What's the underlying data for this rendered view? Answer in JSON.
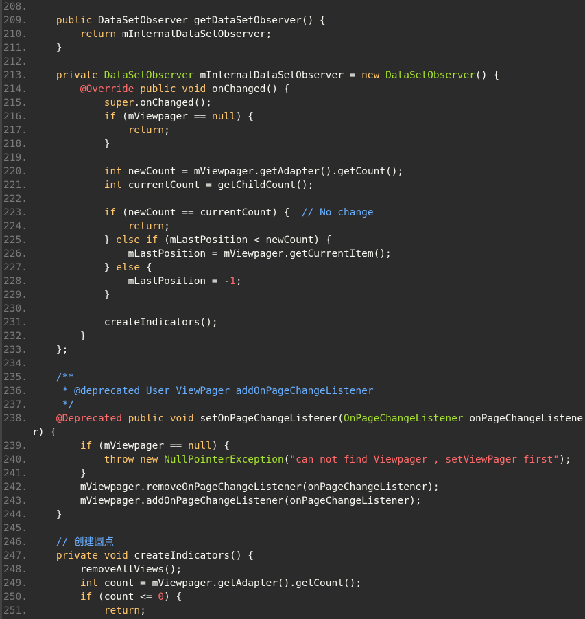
{
  "editor": {
    "lines": [
      {
        "n": "208.",
        "t": []
      },
      {
        "n": "209.",
        "t": [
          [
            "    ",
            "pl"
          ],
          [
            "public ",
            "kw"
          ],
          [
            "DataSetObserver ",
            "pl"
          ],
          [
            "getDataSetObserver() {",
            "pl"
          ]
        ]
      },
      {
        "n": "210.",
        "t": [
          [
            "        ",
            "pl"
          ],
          [
            "return ",
            "kw"
          ],
          [
            "mInternalDataSetObserver;",
            "pl"
          ]
        ]
      },
      {
        "n": "211.",
        "t": [
          [
            "    }",
            "pl"
          ]
        ]
      },
      {
        "n": "212.",
        "t": []
      },
      {
        "n": "213.",
        "t": [
          [
            "    ",
            "pl"
          ],
          [
            "private ",
            "kw"
          ],
          [
            "DataSetObserver ",
            "ty"
          ],
          [
            "mInternalDataSetObserver = ",
            "pl"
          ],
          [
            "new ",
            "kw"
          ],
          [
            "DataSetObserver",
            "ty"
          ],
          [
            "() {",
            "pl"
          ]
        ]
      },
      {
        "n": "214.",
        "t": [
          [
            "        ",
            "pl"
          ],
          [
            "@Override ",
            "ann"
          ],
          [
            "public void ",
            "kw"
          ],
          [
            "onChanged() {",
            "pl"
          ]
        ]
      },
      {
        "n": "215.",
        "t": [
          [
            "            ",
            "pl"
          ],
          [
            "super",
            "kw"
          ],
          [
            ".onChanged();",
            "pl"
          ]
        ]
      },
      {
        "n": "216.",
        "t": [
          [
            "            ",
            "pl"
          ],
          [
            "if ",
            "kw"
          ],
          [
            "(mViewpager == ",
            "pl"
          ],
          [
            "null",
            "kw"
          ],
          [
            ") {",
            "pl"
          ]
        ]
      },
      {
        "n": "217.",
        "t": [
          [
            "                ",
            "pl"
          ],
          [
            "return",
            "kw"
          ],
          [
            ";",
            "pl"
          ]
        ]
      },
      {
        "n": "218.",
        "t": [
          [
            "            }",
            "pl"
          ]
        ]
      },
      {
        "n": "219.",
        "t": []
      },
      {
        "n": "220.",
        "t": [
          [
            "            ",
            "pl"
          ],
          [
            "int ",
            "kw"
          ],
          [
            "newCount = mViewpager.getAdapter().getCount();",
            "pl"
          ]
        ]
      },
      {
        "n": "221.",
        "t": [
          [
            "            ",
            "pl"
          ],
          [
            "int ",
            "kw"
          ],
          [
            "currentCount = getChildCount();",
            "pl"
          ]
        ]
      },
      {
        "n": "222.",
        "t": []
      },
      {
        "n": "223.",
        "t": [
          [
            "            ",
            "pl"
          ],
          [
            "if ",
            "kw"
          ],
          [
            "(newCount == currentCount) {  ",
            "pl"
          ],
          [
            "// No change",
            "cm"
          ]
        ]
      },
      {
        "n": "224.",
        "t": [
          [
            "                ",
            "pl"
          ],
          [
            "return",
            "kw"
          ],
          [
            ";",
            "pl"
          ]
        ]
      },
      {
        "n": "225.",
        "t": [
          [
            "            } ",
            "pl"
          ],
          [
            "else if ",
            "kw"
          ],
          [
            "(mLastPosition < newCount) {",
            "pl"
          ]
        ]
      },
      {
        "n": "226.",
        "t": [
          [
            "                mLastPosition = mViewpager.getCurrentItem();",
            "pl"
          ]
        ]
      },
      {
        "n": "227.",
        "t": [
          [
            "            } ",
            "pl"
          ],
          [
            "else ",
            "kw"
          ],
          [
            "{",
            "pl"
          ]
        ]
      },
      {
        "n": "228.",
        "t": [
          [
            "                mLastPosition = -",
            "pl"
          ],
          [
            "1",
            "num"
          ],
          [
            ";",
            "pl"
          ]
        ]
      },
      {
        "n": "229.",
        "t": [
          [
            "            }",
            "pl"
          ]
        ]
      },
      {
        "n": "230.",
        "t": []
      },
      {
        "n": "231.",
        "t": [
          [
            "            createIndicators();",
            "pl"
          ]
        ]
      },
      {
        "n": "232.",
        "t": [
          [
            "        }",
            "pl"
          ]
        ]
      },
      {
        "n": "233.",
        "t": [
          [
            "    };",
            "pl"
          ]
        ]
      },
      {
        "n": "234.",
        "t": []
      },
      {
        "n": "235.",
        "t": [
          [
            "    /**",
            "cm"
          ]
        ]
      },
      {
        "n": "236.",
        "t": [
          [
            "     * @deprecated User ViewPager addOnPageChangeListener",
            "cm"
          ]
        ]
      },
      {
        "n": "237.",
        "t": [
          [
            "     */",
            "cm"
          ]
        ]
      },
      {
        "n": "238.",
        "t": [
          [
            "    ",
            "pl"
          ],
          [
            "@Deprecated ",
            "ann"
          ],
          [
            "public void ",
            "kw"
          ],
          [
            "setOnPageChangeListener(",
            "pl"
          ],
          [
            "OnPageChangeListener ",
            "ty"
          ],
          [
            "onPageChangeListene",
            "pl"
          ]
        ]
      },
      {
        "n": "",
        "t": [
          [
            "r) {",
            "pl"
          ]
        ]
      },
      {
        "n": "239.",
        "t": [
          [
            "        ",
            "pl"
          ],
          [
            "if ",
            "kw"
          ],
          [
            "(mViewpager == ",
            "pl"
          ],
          [
            "null",
            "kw"
          ],
          [
            ") {",
            "pl"
          ]
        ]
      },
      {
        "n": "240.",
        "t": [
          [
            "            ",
            "pl"
          ],
          [
            "throw new ",
            "kw"
          ],
          [
            "NullPointerException",
            "ty"
          ],
          [
            "(",
            "pl"
          ],
          [
            "\"can not find Viewpager , setViewPager first\"",
            "str"
          ],
          [
            ");",
            "pl"
          ]
        ]
      },
      {
        "n": "241.",
        "t": [
          [
            "        }",
            "pl"
          ]
        ]
      },
      {
        "n": "242.",
        "t": [
          [
            "        mViewpager.removeOnPageChangeListener(onPageChangeListener);",
            "pl"
          ]
        ]
      },
      {
        "n": "243.",
        "t": [
          [
            "        mViewpager.addOnPageChangeListener(onPageChangeListener);",
            "pl"
          ]
        ]
      },
      {
        "n": "244.",
        "t": [
          [
            "    }",
            "pl"
          ]
        ]
      },
      {
        "n": "245.",
        "t": []
      },
      {
        "n": "246.",
        "t": [
          [
            "    // 创建圆点",
            "cm"
          ]
        ]
      },
      {
        "n": "247.",
        "t": [
          [
            "    ",
            "pl"
          ],
          [
            "private void ",
            "kw"
          ],
          [
            "createIndicators() {",
            "pl"
          ]
        ]
      },
      {
        "n": "248.",
        "t": [
          [
            "        removeAllViews();",
            "pl"
          ]
        ]
      },
      {
        "n": "249.",
        "t": [
          [
            "        ",
            "pl"
          ],
          [
            "int ",
            "kw"
          ],
          [
            "count = mViewpager.getAdapter().getCount();",
            "pl"
          ]
        ]
      },
      {
        "n": "250.",
        "t": [
          [
            "        ",
            "pl"
          ],
          [
            "if ",
            "kw"
          ],
          [
            "(count <= ",
            "pl"
          ],
          [
            "0",
            "num"
          ],
          [
            ") {",
            "pl"
          ]
        ]
      },
      {
        "n": "251.",
        "t": [
          [
            "            ",
            "pl"
          ],
          [
            "return",
            "kw"
          ],
          [
            ";",
            "pl"
          ]
        ]
      }
    ]
  }
}
